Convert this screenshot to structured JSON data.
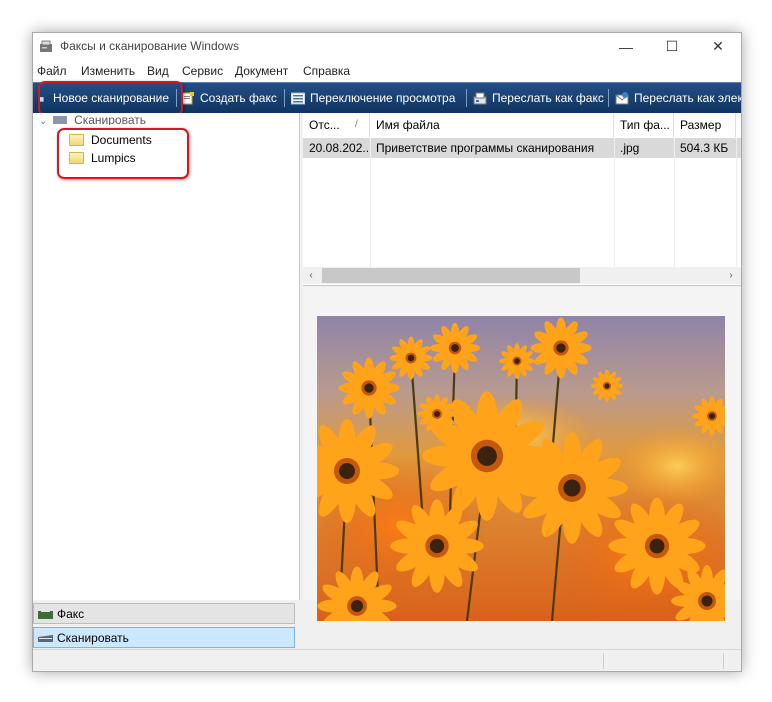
{
  "window": {
    "title": "Факсы и сканирование Windows",
    "controls": {
      "minimize": "—",
      "maximize": "☐",
      "close": "✕"
    }
  },
  "menu": [
    "Файл",
    "Изменить",
    "Вид",
    "Сервис",
    "Документ",
    "Справка"
  ],
  "toolbar": {
    "new_scan": "Новое сканирование",
    "create_fax": "Создать факс",
    "toggle_view": "Переключение просмотра",
    "forward_fax": "Переслать как факс",
    "forward_email": "Переслать как элек"
  },
  "tree": {
    "root": "Сканировать",
    "folders": [
      "Documents",
      "Lumpics"
    ]
  },
  "nav": {
    "fax": "Факс",
    "scan": "Сканировать"
  },
  "list": {
    "columns": [
      "Отс...",
      "Имя файла",
      "Тип фа...",
      "Размер"
    ],
    "sort_indicator": "/",
    "rows": [
      {
        "date": "20.08.202...",
        "name": "Приветствие программы сканирования",
        "type": ".jpg",
        "size": "504.3 КБ"
      }
    ]
  },
  "preview": {
    "image": "orange-daisies-photo"
  },
  "colors": {
    "toolbar": "#1a3f72",
    "highlight": "#d7161f",
    "selected_nav": "#cce8ff",
    "selected_row": "#d9d9d9"
  }
}
